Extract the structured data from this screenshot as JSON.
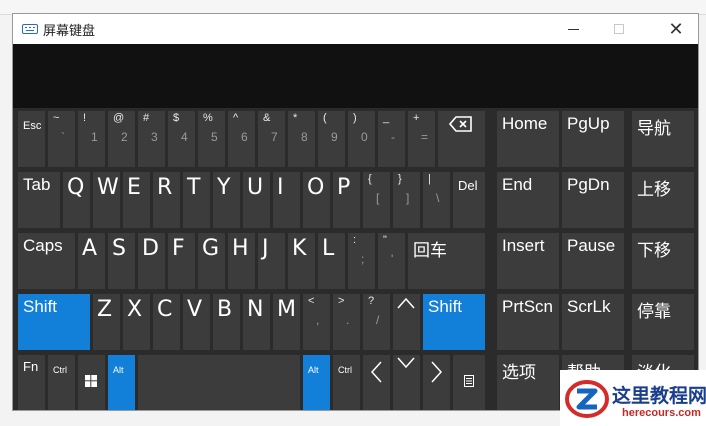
{
  "window": {
    "title": "屏幕键盘"
  },
  "keys": {
    "esc": "Esc",
    "num": [
      {
        "top": "~",
        "bot": "`"
      },
      {
        "top": "!",
        "bot": "1"
      },
      {
        "top": "@",
        "bot": "2"
      },
      {
        "top": "#",
        "bot": "3"
      },
      {
        "top": "$",
        "bot": "4"
      },
      {
        "top": "%",
        "bot": "5"
      },
      {
        "top": "^",
        "bot": "6"
      },
      {
        "top": "&",
        "bot": "7"
      },
      {
        "top": "*",
        "bot": "8"
      },
      {
        "top": "(",
        "bot": "9"
      },
      {
        "top": ")",
        "bot": "0"
      },
      {
        "top": "_",
        "bot": "-"
      },
      {
        "top": "+",
        "bot": "="
      }
    ],
    "tab": "Tab",
    "q": "Q",
    "w": "W",
    "e": "E",
    "r": "R",
    "t": "T",
    "y": "Y",
    "u": "U",
    "i": "I",
    "o": "O",
    "p": "P",
    "brl": {
      "top": "{",
      "bot": "["
    },
    "brr": {
      "top": "}",
      "bot": "]"
    },
    "pipe": {
      "top": "|",
      "bot": "\\"
    },
    "del": "Del",
    "caps": "Caps",
    "a": "A",
    "s": "S",
    "d": "D",
    "f": "F",
    "g": "G",
    "h": "H",
    "j": "J",
    "k": "K",
    "l": "L",
    "semi": {
      "top": ":",
      "bot": ";"
    },
    "quote": {
      "top": "\"",
      "bot": "'"
    },
    "enter": "回车",
    "shift": "Shift",
    "z": "Z",
    "x": "X",
    "c": "C",
    "v": "V",
    "b": "B",
    "n": "N",
    "m": "M",
    "comma": {
      "top": "<",
      "bot": ","
    },
    "period": {
      "top": ">",
      "bot": "."
    },
    "slash": {
      "top": "?",
      "bot": "/"
    },
    "fn": "Fn",
    "ctrl": "Ctrl",
    "alt": "Alt",
    "home": "Home",
    "pgup": "PgUp",
    "nav": "导航",
    "end": "End",
    "pgdn": "PgDn",
    "moveup": "上移",
    "insert": "Insert",
    "pause": "Pause",
    "movedown": "下移",
    "prtscn": "PrtScn",
    "scrlk": "ScrLk",
    "dock": "停靠",
    "options": "选项",
    "help": "帮助",
    "fade": "淡化"
  },
  "colors": {
    "key_bg": "#3c3c3c",
    "active_bg": "#1280d9",
    "keyboard_bg": "#2b2b2b"
  },
  "watermark": {
    "title": "这里教程网",
    "url": "herecours.com"
  }
}
